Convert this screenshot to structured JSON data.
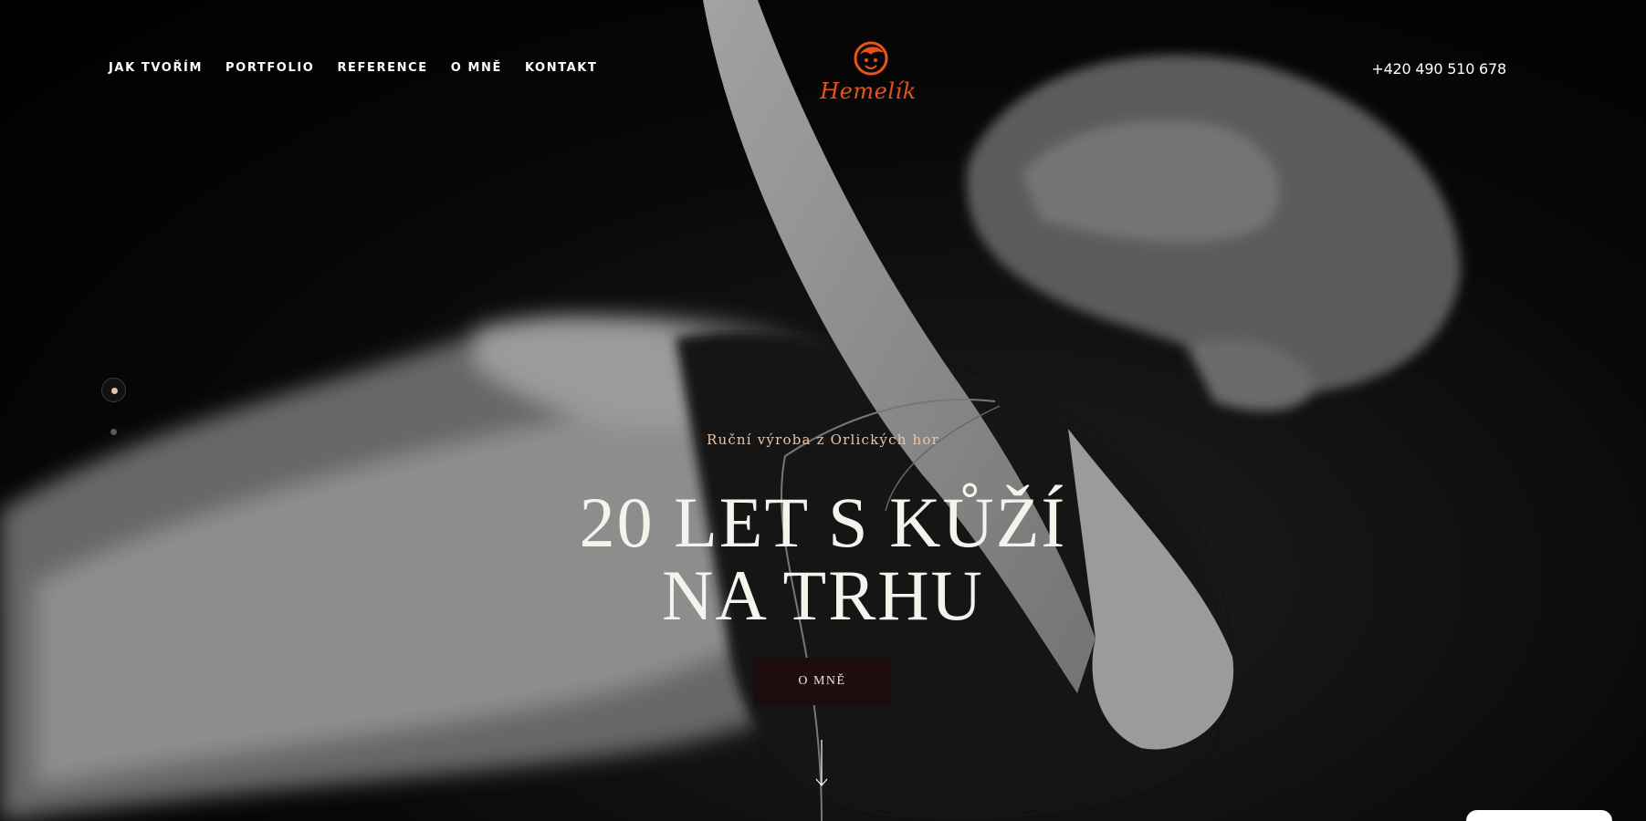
{
  "nav": {
    "items": [
      {
        "label": "JAK TVOŘÍM"
      },
      {
        "label": "PORTFOLIO"
      },
      {
        "label": "REFERENCE"
      },
      {
        "label": "O MNĚ"
      },
      {
        "label": "KONTAKT"
      }
    ]
  },
  "header": {
    "logo_text": "Hemelík",
    "phone": "+420 490 510 678"
  },
  "hero": {
    "tagline": "Ruční výroba z Orlických hor",
    "headline_line1": "20 LET S KŮŽÍ",
    "headline_line2": "NA TRHU",
    "cta_label": "O MNĚ"
  },
  "slider": {
    "active_index": 0,
    "count": 2
  },
  "colors": {
    "brand": "#e8521d",
    "accent": "#e6c6ad",
    "cta_bg": "#1f0c0c"
  },
  "icons": {
    "scroll": "arrow-down-icon",
    "logo": "head-icon"
  }
}
